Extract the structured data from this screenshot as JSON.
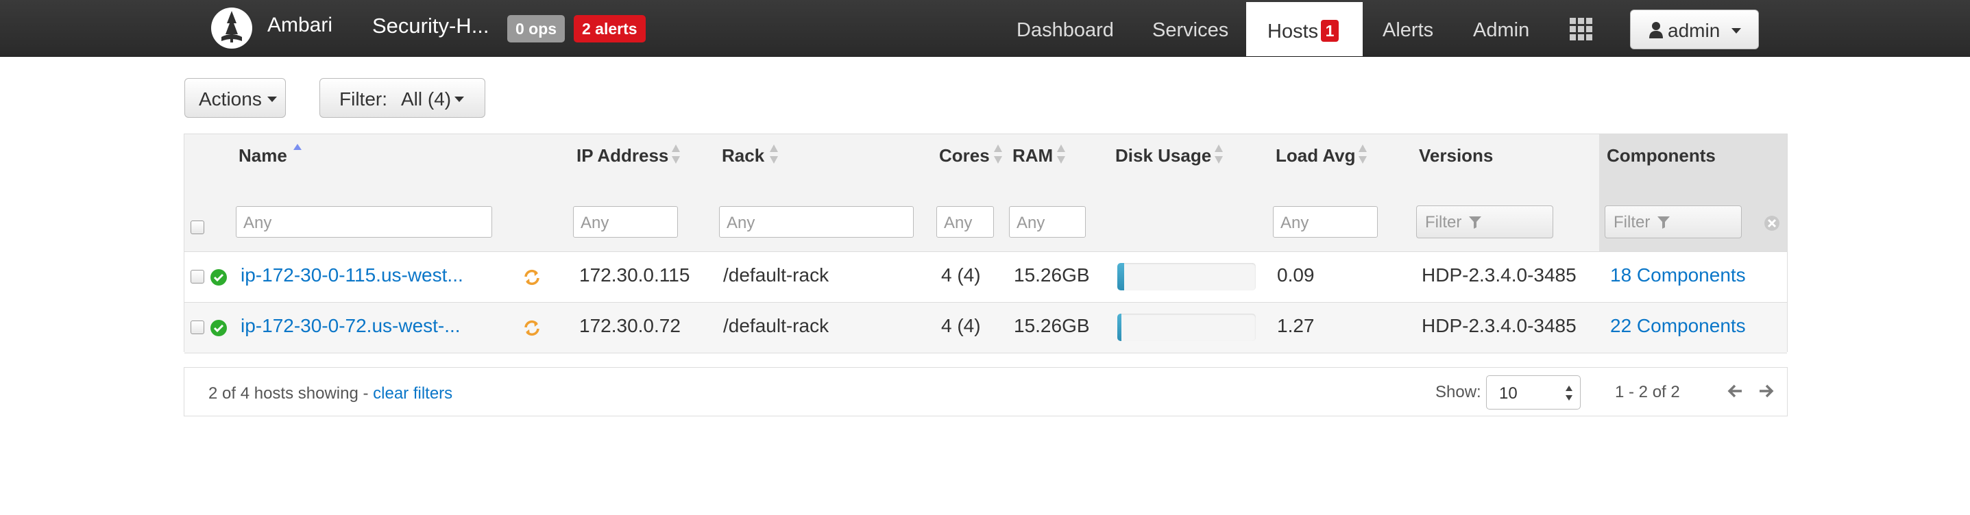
{
  "navbar": {
    "brand": "Ambari",
    "cluster_name": "Security-H...",
    "ops_badge": "0 ops",
    "alerts_badge": "2 alerts",
    "items": [
      {
        "label": "Dashboard"
      },
      {
        "label": "Services"
      },
      {
        "label": "Hosts",
        "count": "1",
        "active": true
      },
      {
        "label": "Alerts"
      },
      {
        "label": "Admin"
      }
    ],
    "user": "admin",
    "icons": {
      "logo": "ambari-logo-icon",
      "apps": "grid-icon",
      "user": "user-icon"
    }
  },
  "toolbar": {
    "actions_label": "Actions",
    "filter_label": "Filter:",
    "filter_value": "All (4)"
  },
  "table": {
    "columns": [
      "Name",
      "IP Address",
      "Rack",
      "Cores",
      "RAM",
      "Disk Usage",
      "Load Avg",
      "Versions",
      "Components"
    ],
    "filters": {
      "name_placeholder": "Any",
      "ip_placeholder": "Any",
      "rack_placeholder": "Any",
      "cores_placeholder": "Any",
      "ram_placeholder": "Any",
      "load_placeholder": "Any",
      "versions_filter_label": "Filter",
      "components_filter_label": "Filter"
    },
    "rows": [
      {
        "name": "ip-172-30-0-115.us-west...",
        "ip": "172.30.0.115",
        "rack": "/default-rack",
        "cores": "4 (4)",
        "ram": "15.26GB",
        "disk_usage_fraction": 0.05,
        "load_avg": "0.09",
        "version": "HDP-2.3.4.0-3485",
        "components": "18 Components"
      },
      {
        "name": "ip-172-30-0-72.us-west-...",
        "ip": "172.30.0.72",
        "rack": "/default-rack",
        "cores": "4 (4)",
        "ram": "15.26GB",
        "disk_usage_fraction": 0.03,
        "load_avg": "1.27",
        "version": "HDP-2.3.4.0-3485",
        "components": "22 Components"
      }
    ]
  },
  "footer": {
    "summary": "2 of 4 hosts showing - ",
    "clear_filters": "clear filters",
    "show_label": "Show:",
    "page_size": "10",
    "range": "1 - 2 of 2"
  },
  "colors": {
    "navbar": "#2f2f2f",
    "link": "#0a76c8",
    "alert_red": "#d9151d",
    "ok_green": "#2eac2e",
    "restart_orange": "#f0a030",
    "disk_bar": "#3a9cc3"
  }
}
